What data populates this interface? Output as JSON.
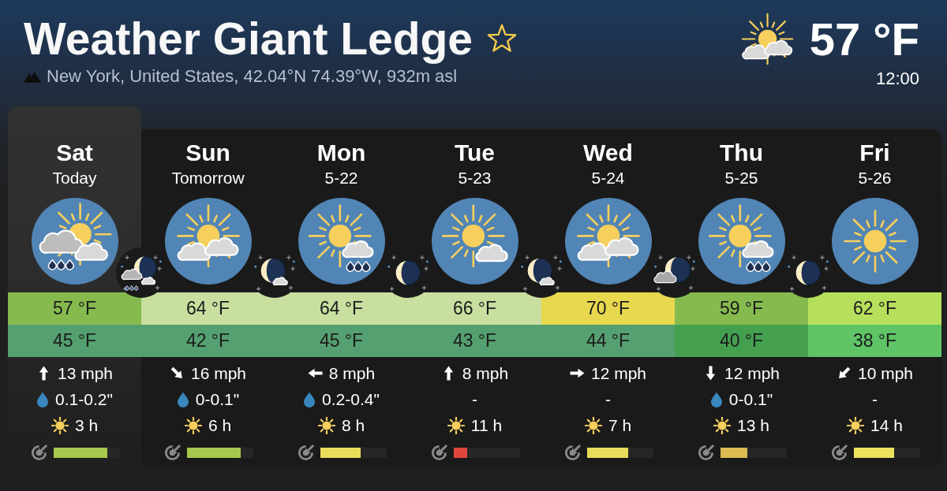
{
  "header": {
    "title": "Weather Giant Ledge",
    "favorite": false,
    "location": "New York, United States, 42.04°N 74.39°W, 932m asl"
  },
  "current": {
    "icon": {
      "kind": "sun-two-clouds"
    },
    "temperature": "57 °F",
    "time": "12:00"
  },
  "days": [
    {
      "name": "Sat",
      "date": "Today",
      "selected": true,
      "icon": {
        "kind": "cloud-sun-rain"
      },
      "night_icon": {
        "kind": "moon-clouds-rain"
      },
      "high": {
        "value": "57 °F",
        "color": "#86ba4f"
      },
      "low": {
        "value": "45 °F",
        "color": "#55a070"
      },
      "wind": {
        "arrow": {
          "kind": "up"
        },
        "speed": "13 mph"
      },
      "precipitation": {
        "amount": "0.1-0.2\"",
        "rain": true
      },
      "sunshine": "3 h",
      "predictability": {
        "level": 0.81,
        "color": "#a6c84e"
      }
    },
    {
      "name": "Sun",
      "date": "Tomorrow",
      "selected": false,
      "icon": {
        "kind": "sun-two-clouds"
      },
      "night_icon": {
        "kind": "moon-cloud"
      },
      "high": {
        "value": "64 °F",
        "color": "#c8dfa0"
      },
      "low": {
        "value": "42 °F",
        "color": "#55a070"
      },
      "wind": {
        "arrow": {
          "kind": "down-right"
        },
        "speed": "16 mph"
      },
      "precipitation": {
        "amount": "0-0.1\"",
        "rain": true
      },
      "sunshine": "6 h",
      "predictability": {
        "level": 0.81,
        "color": "#a6c84e"
      }
    },
    {
      "name": "Mon",
      "date": "5-22",
      "selected": false,
      "icon": {
        "kind": "sun-rain-cloud"
      },
      "night_icon": {
        "kind": "moon"
      },
      "high": {
        "value": "64 °F",
        "color": "#c8dfa0"
      },
      "low": {
        "value": "45 °F",
        "color": "#55a070"
      },
      "wind": {
        "arrow": {
          "kind": "left"
        },
        "speed": "8 mph"
      },
      "precipitation": {
        "amount": "0.2-0.4\"",
        "rain": true
      },
      "sunshine": "8 h",
      "predictability": {
        "level": 0.61,
        "color": "#e8dc5a"
      }
    },
    {
      "name": "Tue",
      "date": "5-23",
      "selected": false,
      "icon": {
        "kind": "sun-cloud"
      },
      "night_icon": {
        "kind": "moon-cloud"
      },
      "high": {
        "value": "66 °F",
        "color": "#c8dfa0"
      },
      "low": {
        "value": "43 °F",
        "color": "#55a070"
      },
      "wind": {
        "arrow": {
          "kind": "up"
        },
        "speed": "8 mph"
      },
      "precipitation": {
        "amount": "-",
        "rain": false
      },
      "sunshine": "11 h",
      "predictability": {
        "level": 0.2,
        "color": "#e0463c"
      }
    },
    {
      "name": "Wed",
      "date": "5-24",
      "selected": false,
      "icon": {
        "kind": "sun-two-clouds"
      },
      "night_icon": {
        "kind": "moon-big-cloud"
      },
      "high": {
        "value": "70 °F",
        "color": "#e8d84e"
      },
      "low": {
        "value": "44 °F",
        "color": "#55a070"
      },
      "wind": {
        "arrow": {
          "kind": "right"
        },
        "speed": "12 mph"
      },
      "precipitation": {
        "amount": "-",
        "rain": false
      },
      "sunshine": "7 h",
      "predictability": {
        "level": 0.62,
        "color": "#e8dc5a"
      }
    },
    {
      "name": "Thu",
      "date": "5-25",
      "selected": false,
      "icon": {
        "kind": "sun-rain-cloud"
      },
      "night_icon": {
        "kind": "moon"
      },
      "high": {
        "value": "59 °F",
        "color": "#86ba4f"
      },
      "low": {
        "value": "40 °F",
        "color": "#44a04f"
      },
      "wind": {
        "arrow": {
          "kind": "down"
        },
        "speed": "12 mph"
      },
      "precipitation": {
        "amount": "0-0.1\"",
        "rain": true
      },
      "sunshine": "13 h",
      "predictability": {
        "level": 0.41,
        "color": "#dcbc52"
      }
    },
    {
      "name": "Fri",
      "date": "5-26",
      "selected": false,
      "icon": {
        "kind": "sunny"
      },
      "high": {
        "value": "62 °F",
        "color": "#b6e05c"
      },
      "low": {
        "value": "38 °F",
        "color": "#5ec466"
      },
      "wind": {
        "arrow": {
          "kind": "down-left"
        },
        "speed": "10 mph"
      },
      "precipitation": {
        "amount": "-",
        "rain": false
      },
      "sunshine": "14 h",
      "predictability": {
        "level": 0.61,
        "color": "#ece25e"
      }
    }
  ]
}
